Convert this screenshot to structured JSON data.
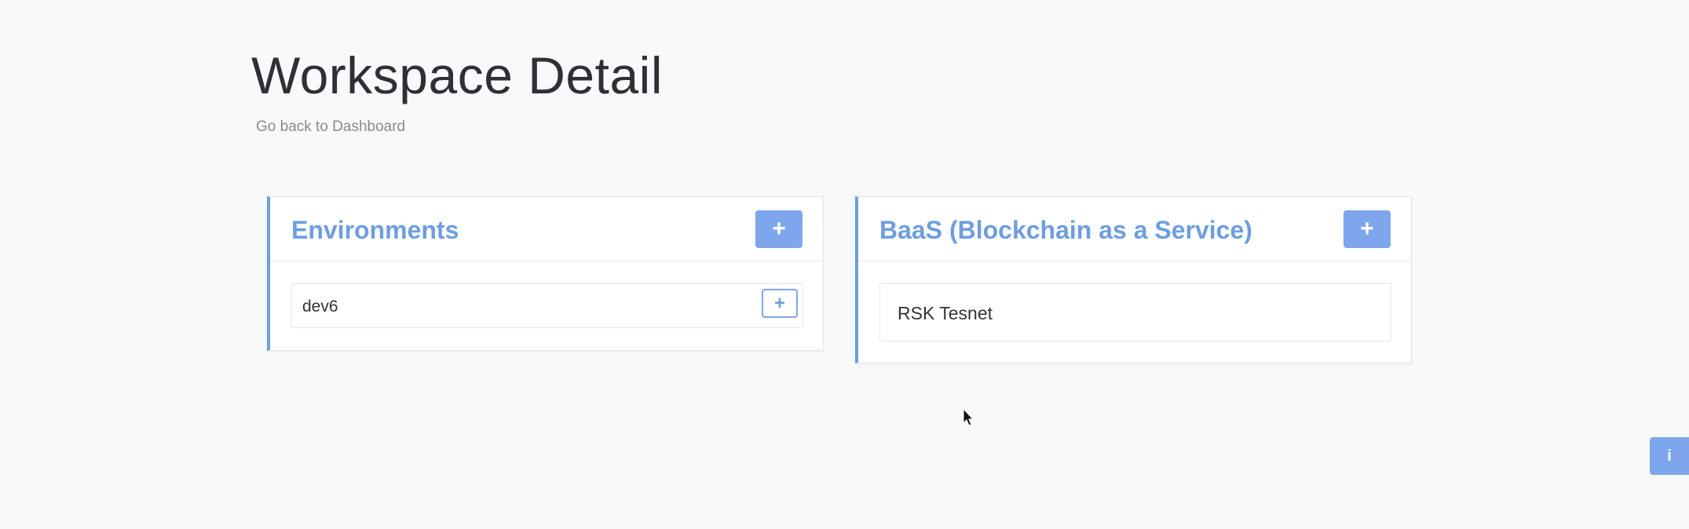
{
  "page": {
    "title": "Workspace Detail",
    "back_link": "Go back to Dashboard"
  },
  "environments": {
    "title": "Environments",
    "add_button": "+",
    "items": [
      {
        "label": "dev6",
        "add_button": "+"
      }
    ]
  },
  "baas": {
    "title": "BaaS (Blockchain as a Service)",
    "add_button": "+",
    "items": [
      {
        "label": "RSK Tesnet"
      }
    ]
  },
  "info_button": "i",
  "colors": {
    "accent": "#6e9ee0",
    "button": "#7ea6ec",
    "background": "#f8f9fb"
  },
  "icons": {
    "add": "plus-icon",
    "info": "info-icon",
    "cursor": "mouse-pointer-icon"
  }
}
